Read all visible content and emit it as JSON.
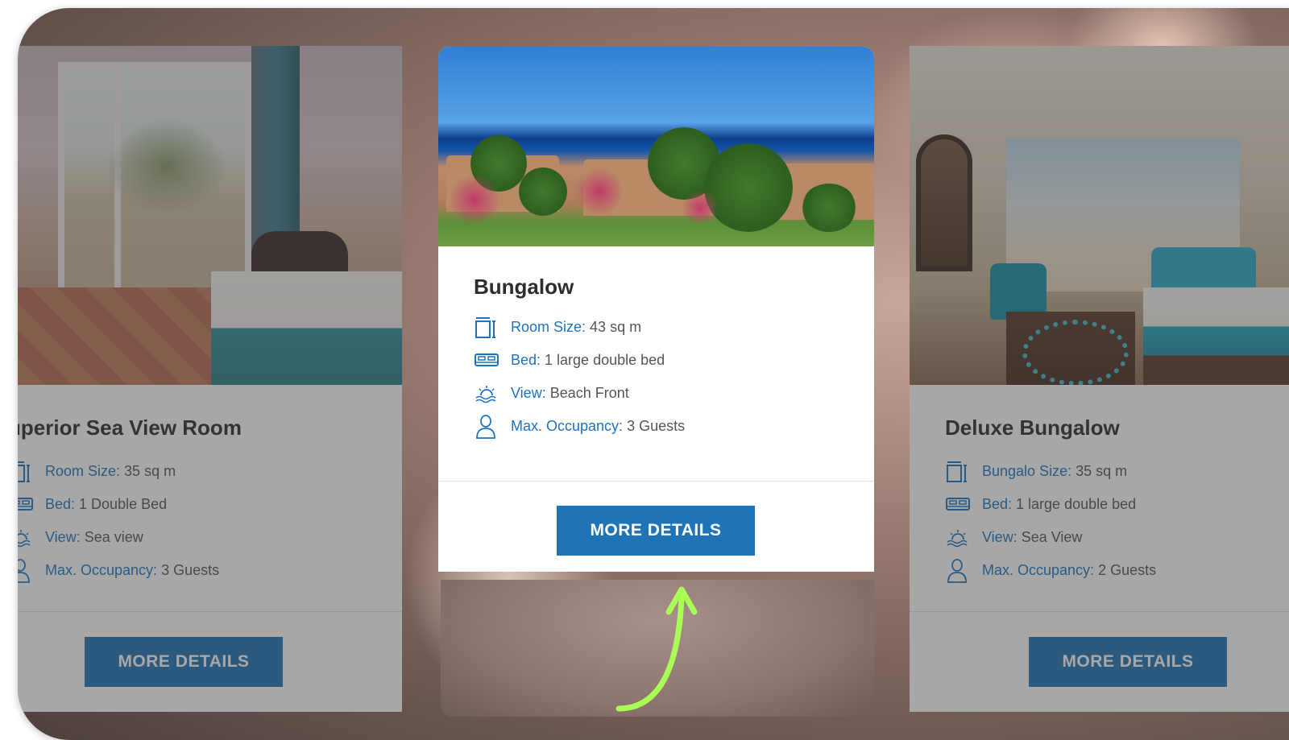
{
  "colors": {
    "accent": "#1f73b7",
    "label": "#1e73be",
    "arrow": "#aaff55"
  },
  "cards": {
    "left": {
      "title": "uperior Sea View Room",
      "features": [
        {
          "icon": "room-size-icon",
          "label": "Room Size:",
          "value": "35 sq m"
        },
        {
          "icon": "bed-icon",
          "label": "Bed:",
          "value": "1 Double Bed"
        },
        {
          "icon": "view-icon",
          "label": "View:",
          "value": "Sea view"
        },
        {
          "icon": "occupancy-icon",
          "label": "Max. Occupancy:",
          "value": "3 Guests"
        }
      ],
      "button": "MORE DETAILS"
    },
    "center": {
      "title": "Bungalow",
      "features": [
        {
          "icon": "room-size-icon",
          "label": "Room Size:",
          "value": "43 sq m"
        },
        {
          "icon": "bed-icon",
          "label": "Bed:",
          "value": "1 large double bed"
        },
        {
          "icon": "view-icon",
          "label": "View:",
          "value": "Beach Front"
        },
        {
          "icon": "occupancy-icon",
          "label": "Max. Occupancy:",
          "value": "3 Guests"
        }
      ],
      "button": "MORE DETAILS"
    },
    "right": {
      "title": "Deluxe Bungalow",
      "features": [
        {
          "icon": "room-size-icon",
          "label": "Bungalo Size:",
          "value": "35 sq m"
        },
        {
          "icon": "bed-icon",
          "label": "Bed:",
          "value": "1 large double bed"
        },
        {
          "icon": "view-icon",
          "label": "View:",
          "value": "Sea View"
        },
        {
          "icon": "occupancy-icon",
          "label": "Max. Occupancy:",
          "value": "2 Guests"
        }
      ],
      "button": "MORE DETAILS"
    }
  }
}
